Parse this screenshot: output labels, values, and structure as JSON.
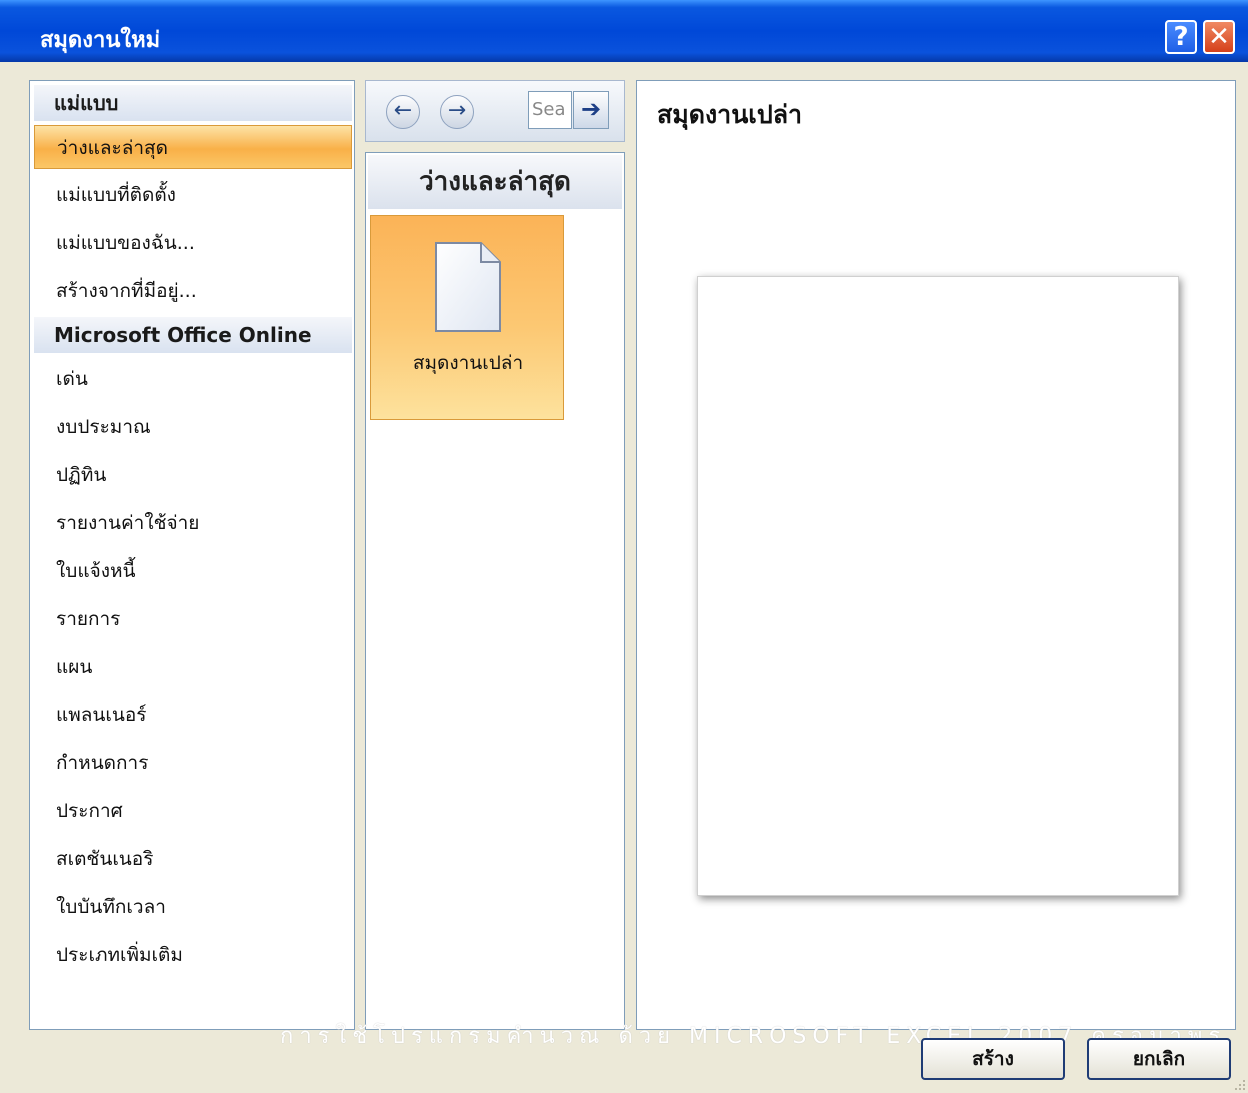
{
  "window": {
    "title": "สมุดงานใหม่",
    "help_label": "?",
    "close_label": "✕"
  },
  "left_pane": {
    "groups": [
      {
        "header": "แม่แบบ",
        "items": [
          "ว่างและล่าสุด",
          "แม่แบบที่ติดตั้ง",
          "แม่แบบของฉัน...",
          "สร้างจากที่มีอยู่..."
        ]
      },
      {
        "header": "Microsoft Office Online",
        "items": [
          "เด่น",
          "งบประมาณ",
          "ปฏิทิน",
          "รายงานค่าใช้จ่าย",
          "ใบแจ้งหนี้",
          "รายการ",
          "แผน",
          "แพลนเนอร์",
          "กำหนดการ",
          "ประกาศ",
          "สเตชันเนอริ",
          "ใบบันทึกเวลา",
          "ประเภทเพิ่มเติม"
        ]
      }
    ],
    "selected_item": "ว่างและล่าสุด"
  },
  "middle_pane": {
    "nav": {
      "back_icon": "back-arrow-icon",
      "forward_icon": "forward-arrow-icon"
    },
    "search": {
      "value": "Sea",
      "go_icon": "go-arrow-icon"
    },
    "header": "ว่างและล่าสุด",
    "tiles": [
      {
        "label": "สมุดงานเปล่า",
        "icon": "blank-document-icon"
      }
    ]
  },
  "right_pane": {
    "preview_title": "สมุดงานเปล่า"
  },
  "footer": {
    "caption": "การใช้โปรแกรมคำนวณ ด้วย MICROSOFT EXCEL 2007 ครูอมาพร",
    "create_label": "สร้าง",
    "cancel_label": "ยกเลิก"
  },
  "colors": {
    "title_bar": "#0048d8",
    "selected_orange": "#f9b048",
    "close_red": "#d5401a"
  }
}
